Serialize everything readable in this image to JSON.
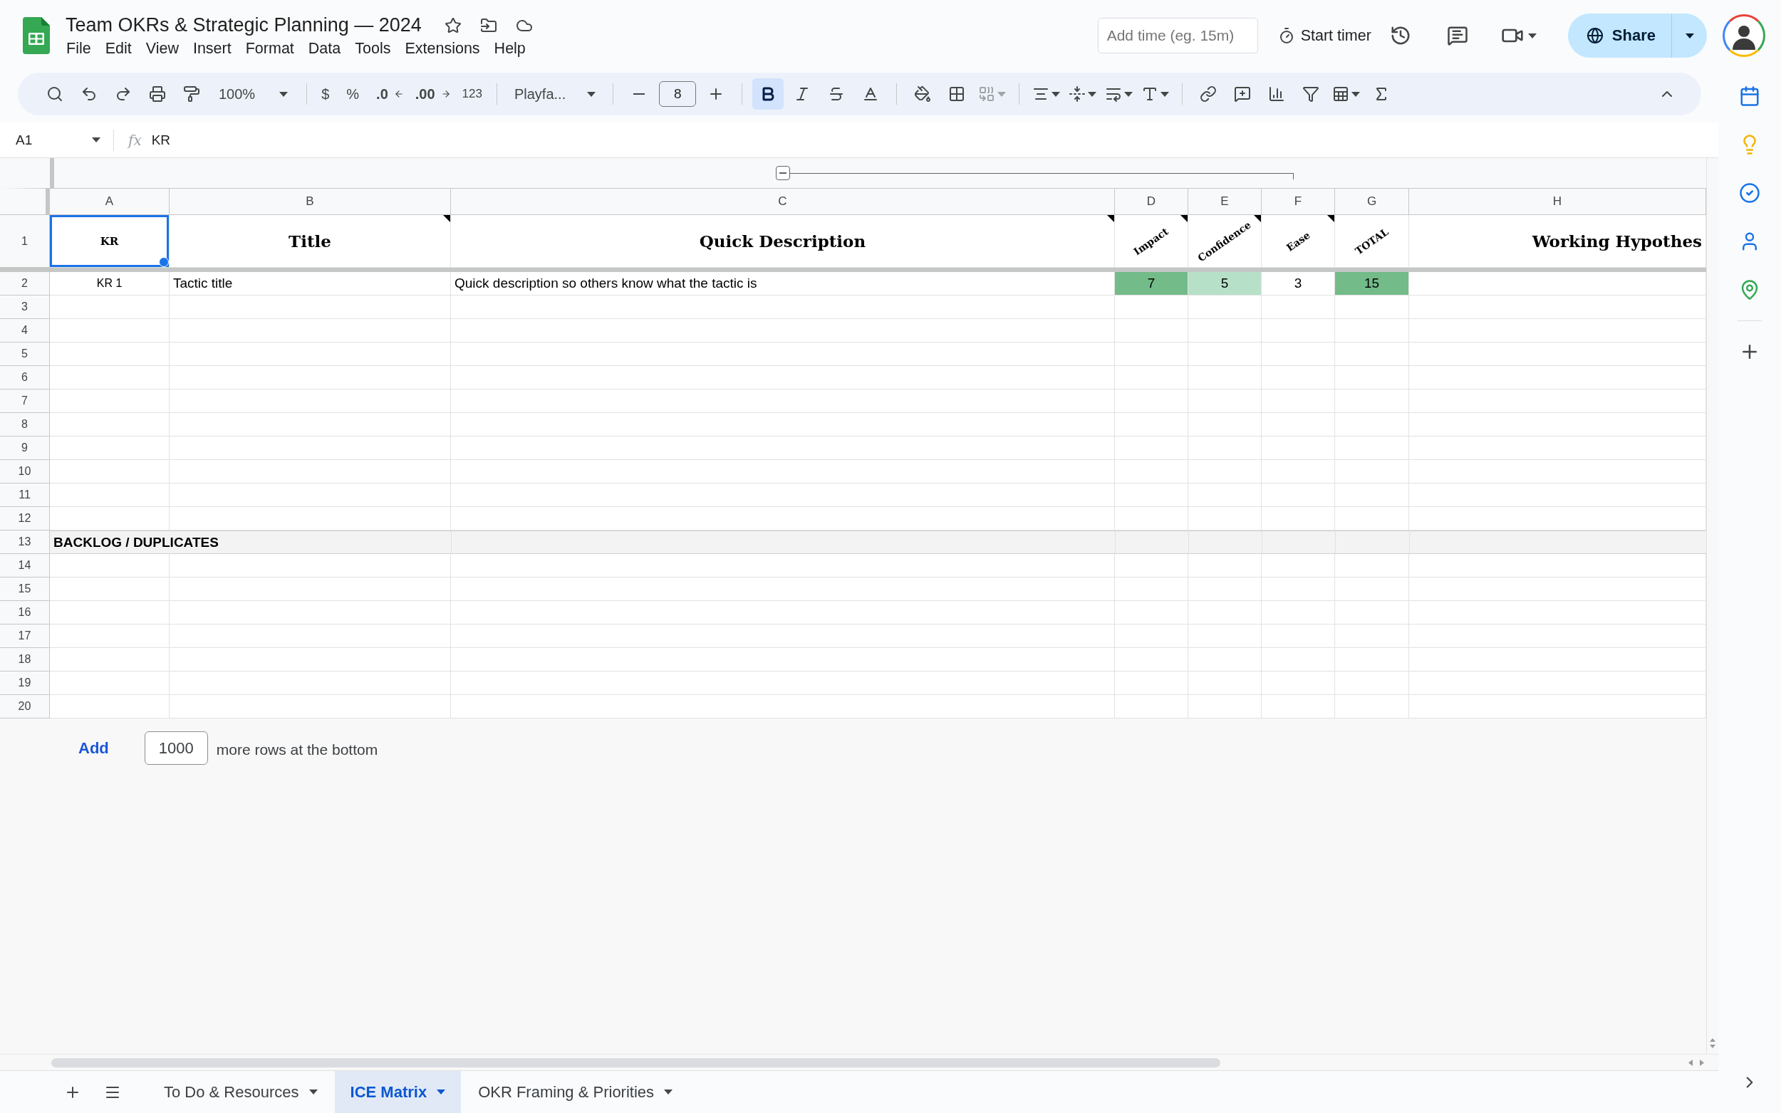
{
  "document": {
    "title": "Team OKRs & Strategic Planning — 2024"
  },
  "menu": [
    "File",
    "Edit",
    "View",
    "Insert",
    "Format",
    "Data",
    "Tools",
    "Extensions",
    "Help"
  ],
  "header": {
    "time_field": {
      "placeholder": "Add time (eg. 15m)"
    },
    "timer_button": "Start timer",
    "share_button": "Share"
  },
  "toolbar": {
    "zoom": "100%",
    "currency": "$",
    "percent": "%",
    "decrease_decimal": ".0",
    "increase_decimal": ".00",
    "number_format": "123",
    "font": "Playfa...",
    "font_size": "8",
    "bold": {
      "selected": true
    },
    "italic": {
      "selected": false
    },
    "strikethrough": {
      "selected": false
    }
  },
  "formula_bar": {
    "cell": "A1",
    "label": "fx",
    "formula": "KR"
  },
  "columns": [
    "A",
    "B",
    "C",
    "D",
    "E",
    "F",
    "G",
    "H"
  ],
  "rows": [
    {
      "number": "1",
      "kind": "header",
      "cells": [
        {
          "text": "KR",
          "note": false,
          "selected": true
        },
        {
          "text": "Title",
          "note": true,
          "selected": false
        },
        {
          "text": "Quick Description",
          "note": true,
          "selected": false
        },
        {
          "text": "Impact",
          "note": true,
          "selected": false
        },
        {
          "text": "Confidence",
          "note": true,
          "selected": false
        },
        {
          "text": "Ease",
          "note": true,
          "selected": false
        },
        {
          "text": "TOTAL",
          "note": false,
          "selected": false
        },
        {
          "text": "Working Hypothes",
          "note": false,
          "selected": false
        }
      ]
    },
    {
      "number": "2",
      "kind": "data",
      "cells": [
        {
          "text": "KR 1",
          "selected": false
        },
        {
          "text": "Tactic title",
          "selected": false
        },
        {
          "text": "Quick description so others know what the tactic is",
          "selected": false
        },
        {
          "text": "7",
          "color": "#73bb89",
          "selected": false
        },
        {
          "text": "5",
          "color": "#b7e0c8",
          "selected": false
        },
        {
          "text": "3",
          "selected": false
        },
        {
          "text": "15",
          "color": "#73bb89",
          "selected": false
        }
      ]
    },
    {
      "number": "3",
      "kind": "empty"
    },
    {
      "number": "4",
      "kind": "empty"
    },
    {
      "number": "5",
      "kind": "empty"
    },
    {
      "number": "6",
      "kind": "empty"
    },
    {
      "number": "7",
      "kind": "empty"
    },
    {
      "number": "8",
      "kind": "empty"
    },
    {
      "number": "9",
      "kind": "empty"
    },
    {
      "number": "10",
      "kind": "empty"
    },
    {
      "number": "11",
      "kind": "empty"
    },
    {
      "number": "12",
      "kind": "empty"
    },
    {
      "number": "13",
      "kind": "section",
      "label": "BACKLOG / DUPLICATES"
    },
    {
      "number": "14",
      "kind": "empty"
    },
    {
      "number": "15",
      "kind": "empty"
    },
    {
      "number": "16",
      "kind": "empty"
    },
    {
      "number": "17",
      "kind": "empty"
    },
    {
      "number": "18",
      "kind": "empty"
    },
    {
      "number": "19",
      "kind": "empty"
    },
    {
      "number": "20",
      "kind": "empty"
    }
  ],
  "add_rows": {
    "button": "Add",
    "count": "1000",
    "suffix": "more rows at the bottom"
  },
  "sheets": [
    {
      "name": "To Do & Resources",
      "selected": false
    },
    {
      "name": "ICE Matrix",
      "selected": true
    },
    {
      "name": "OKR Framing & Priorities",
      "selected": false
    }
  ]
}
